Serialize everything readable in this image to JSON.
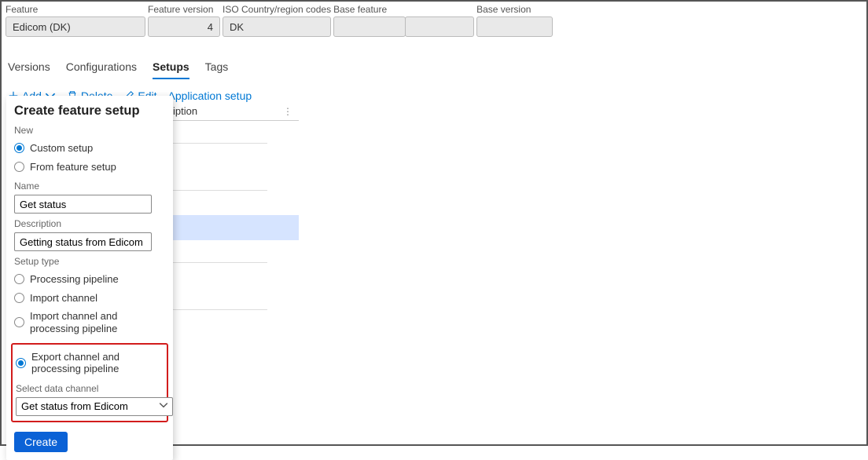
{
  "top": {
    "feature_label": "Feature",
    "feature_value": "Edicom (DK)",
    "version_label": "Feature version",
    "version_value": "4",
    "iso_label": "ISO Country/region codes",
    "iso_value": "DK",
    "basef_label": "Base feature",
    "basef1_value": "",
    "basef2_value": "",
    "basev_label": "Base version",
    "basev_value": ""
  },
  "tabs": {
    "versions": "Versions",
    "configurations": "Configurations",
    "setups": "Setups",
    "tags": "Tags"
  },
  "toolbar": {
    "add": "Add",
    "delete": "Delete",
    "edit": "Edit",
    "appsetup": "Application setup"
  },
  "grid": {
    "col_desc": "iption"
  },
  "popover": {
    "title": "Create feature setup",
    "new_label": "New",
    "opt_custom": "Custom setup",
    "opt_fromfeature": "From feature setup",
    "name_label": "Name",
    "name_value": "Get status",
    "desc_label": "Description",
    "desc_value": "Getting status from Edicom",
    "setuptype_label": "Setup type",
    "st_processing": "Processing pipeline",
    "st_import": "Import channel",
    "st_import_proc": "Import channel and processing pipeline",
    "st_export_proc": "Export channel and processing pipeline",
    "datachannel_label": "Select data channel",
    "datachannel_value": "Get status from Edicom",
    "create": "Create"
  }
}
